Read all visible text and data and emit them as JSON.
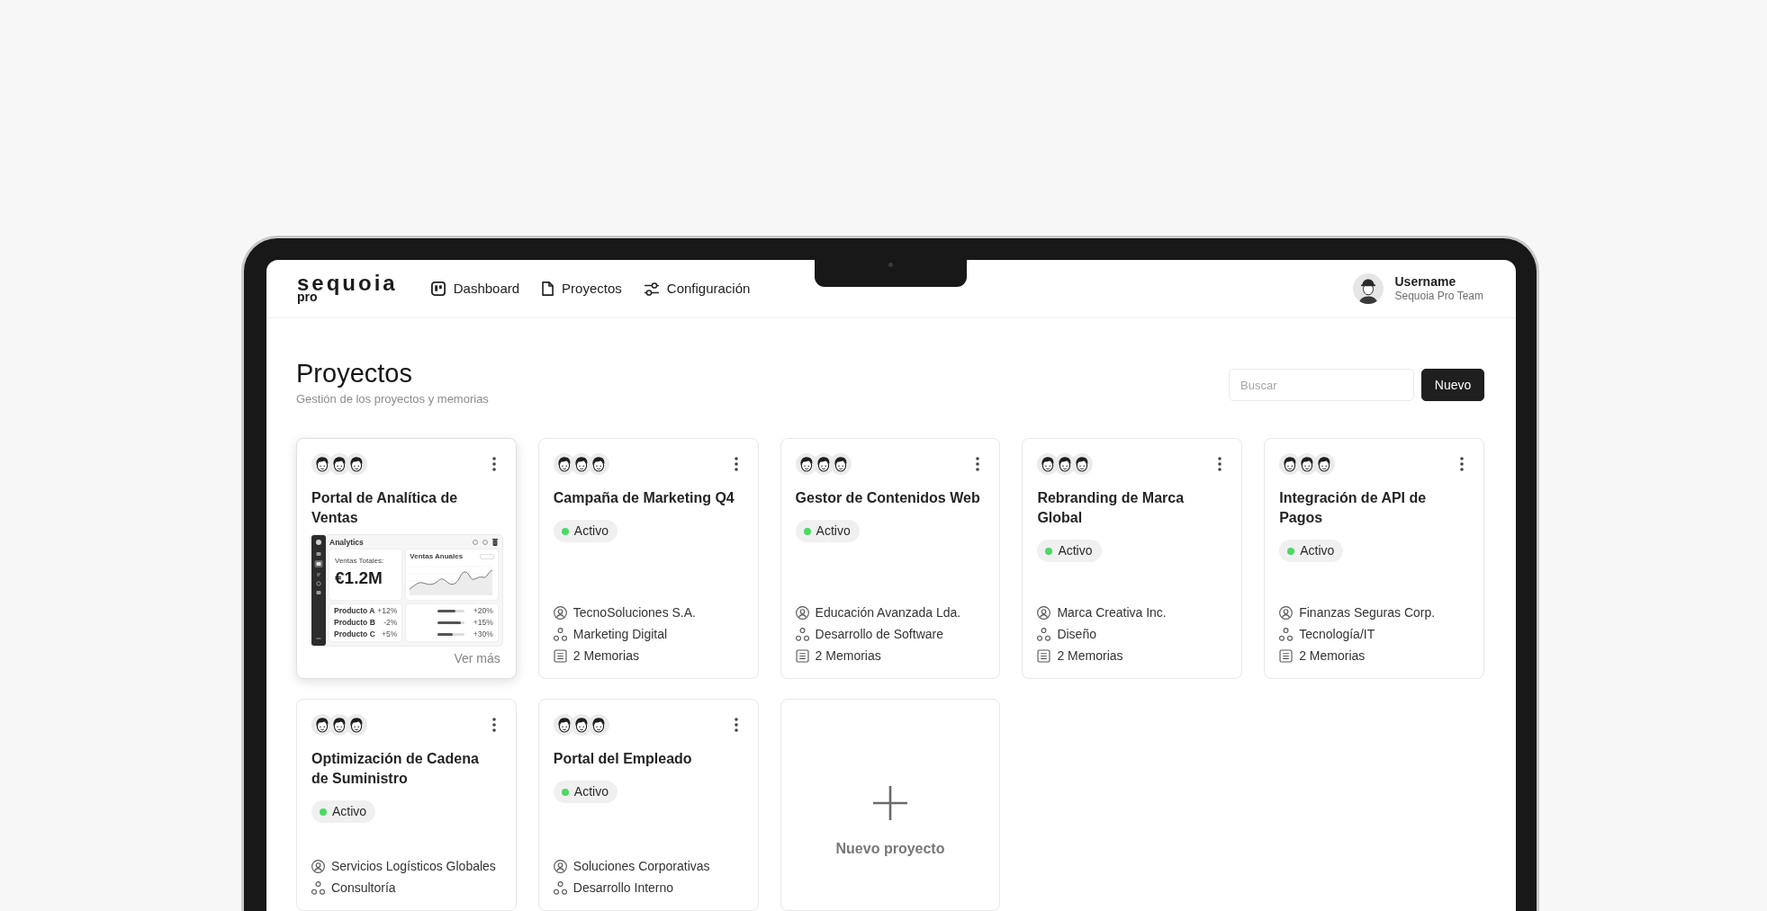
{
  "brand": {
    "name": "sequoia",
    "suffix": "pro"
  },
  "nav": [
    {
      "kind": "dashboard",
      "label": "Dashboard"
    },
    {
      "kind": "projects",
      "label": "Proyectos"
    },
    {
      "kind": "settings",
      "label": "Configuración"
    }
  ],
  "user": {
    "name": "Username",
    "team": "Sequoia Pro Team"
  },
  "page": {
    "title": "Proyectos",
    "subtitle": "Gestión de los proyectos y memorias"
  },
  "search": {
    "placeholder": "Buscar"
  },
  "new_button": "Nuevo",
  "projects": [
    {
      "kind": "preview",
      "title": "Portal de Analítica de Ventas",
      "preview": {
        "app_title": "Analytics",
        "kpi_label": "Ventas Totales:",
        "kpi_value": "€1.2M",
        "chart_title": "Ventas Anuales",
        "products": [
          {
            "name": "Producto A",
            "change": "+12%"
          },
          {
            "name": "Producto B",
            "change": "-2%"
          },
          {
            "name": "Producto C",
            "change": "+5%"
          }
        ],
        "bars": [
          {
            "level": 0.65,
            "reading": "+20%"
          },
          {
            "level": 0.85,
            "reading": "+15%"
          },
          {
            "level": 0.55,
            "reading": "+30%"
          }
        ]
      },
      "link": "Ver más"
    },
    {
      "kind": "summary",
      "title": "Campaña de Marketing Q4",
      "status": {
        "label": "Activo",
        "color": "#4cd964"
      },
      "details": [
        {
          "kind": "client",
          "text": "TecnoSoluciones S.A."
        },
        {
          "kind": "area",
          "text": "Marketing Digital"
        },
        {
          "kind": "memories",
          "text": "2 Memorias"
        }
      ]
    },
    {
      "kind": "summary",
      "title": "Gestor de Contenidos Web",
      "status": {
        "label": "Activo",
        "color": "#4cd964"
      },
      "details": [
        {
          "kind": "client",
          "text": "Educación Avanzada Lda."
        },
        {
          "kind": "area",
          "text": "Desarrollo de Software"
        },
        {
          "kind": "memories",
          "text": "2 Memorias"
        }
      ]
    },
    {
      "kind": "summary",
      "title": "Rebranding de Marca Global",
      "status": {
        "label": "Activo",
        "color": "#4cd964"
      },
      "details": [
        {
          "kind": "client",
          "text": "Marca Creativa Inc."
        },
        {
          "kind": "area",
          "text": "Diseño"
        },
        {
          "kind": "memories",
          "text": "2 Memorias"
        }
      ]
    },
    {
      "kind": "summary",
      "title": "Integración de API de Pagos",
      "status": {
        "label": "Activo",
        "color": "#4cd964"
      },
      "details": [
        {
          "kind": "client",
          "text": "Finanzas Seguras Corp."
        },
        {
          "kind": "area",
          "text": "Tecnología/IT"
        },
        {
          "kind": "memories",
          "text": "2 Memorias"
        }
      ]
    },
    {
      "kind": "summary",
      "title": "Optimización de Cadena de Suministro",
      "status": {
        "label": "Activo",
        "color": "#4cd964"
      },
      "details": [
        {
          "kind": "client",
          "text": "Servicios Logísticos Globales"
        },
        {
          "kind": "area",
          "text": "Consultoría"
        }
      ]
    },
    {
      "kind": "summary",
      "title": "Portal del Empleado",
      "status": {
        "label": "Activo",
        "color": "#4cd964"
      },
      "details": [
        {
          "kind": "client",
          "text": "Soluciones Corporativas"
        },
        {
          "kind": "area",
          "text": "Desarrollo Interno"
        }
      ]
    }
  ],
  "new_project": {
    "label": "Nuevo proyecto"
  }
}
